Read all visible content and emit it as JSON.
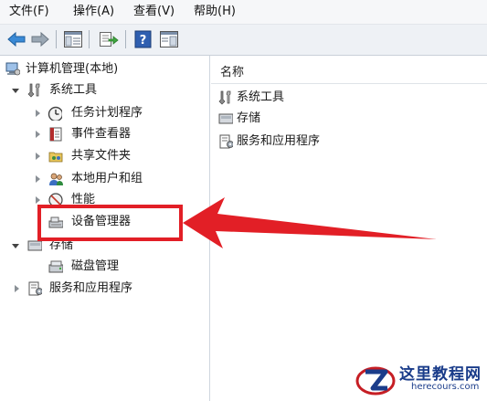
{
  "menubar": {
    "items": [
      "文件(F)",
      "操作(A)",
      "查看(V)",
      "帮助(H)"
    ]
  },
  "toolbar": {
    "buttons": [
      {
        "icon": "back-arrow-icon"
      },
      {
        "icon": "forward-arrow-icon"
      },
      {
        "icon": "show-hide-console-tree-icon"
      },
      {
        "icon": "export-list-icon"
      },
      {
        "icon": "help-icon"
      },
      {
        "icon": "show-hide-action-pane-icon"
      }
    ]
  },
  "tree": {
    "root": "计算机管理(本地)",
    "system_tools": "系统工具",
    "task_scheduler": "任务计划程序",
    "event_viewer": "事件查看器",
    "shared_folders": "共享文件夹",
    "local_users": "本地用户和组",
    "performance": "性能",
    "device_manager": "设备管理器",
    "storage": "存储",
    "disk_management": "磁盘管理",
    "services_apps": "服务和应用程序"
  },
  "list": {
    "header": "名称",
    "items": [
      "系统工具",
      "存储",
      "服务和应用程序"
    ]
  },
  "watermark": {
    "title": "这里教程网",
    "url": "herecours.com"
  },
  "colors": {
    "highlight": "#e21f26",
    "toolbar_bg": "#eef1f5",
    "menubar_bg": "#f6f7f9"
  }
}
